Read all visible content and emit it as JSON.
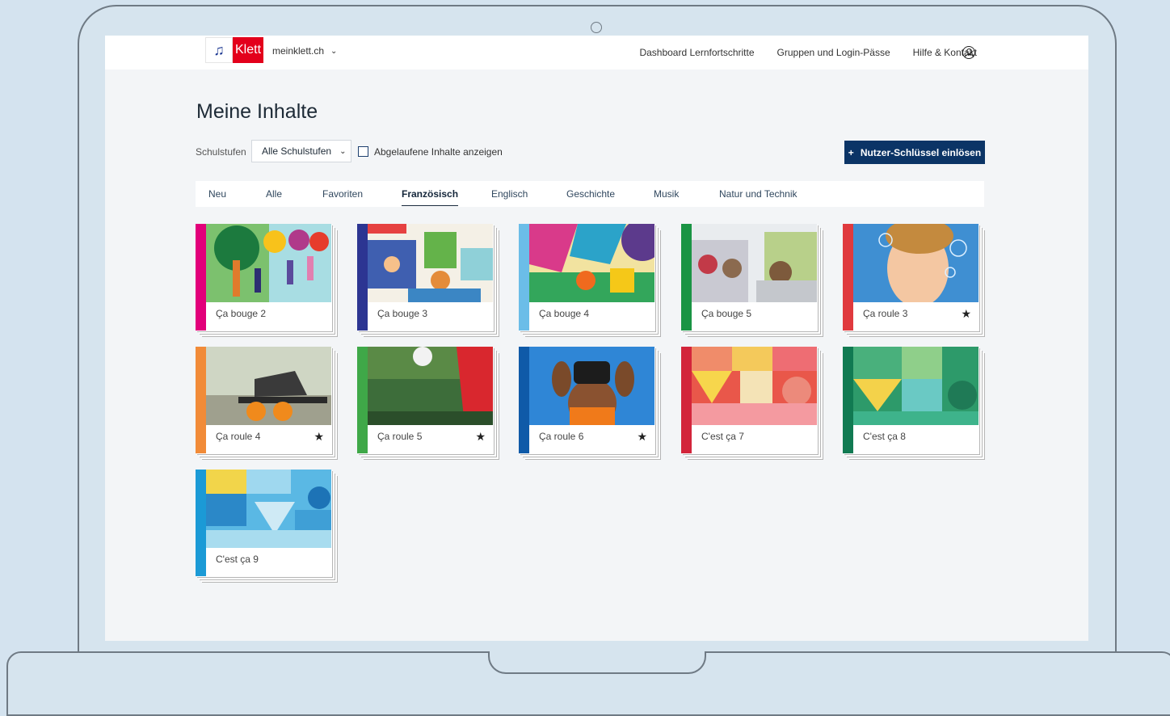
{
  "header": {
    "logo_mark": "♫",
    "logo_text": "Klett",
    "site": "meinklett.ch",
    "nav": [
      "Dashboard Lernfortschritte",
      "Gruppen und Login-Pässe",
      "Hilfe & Kontakt"
    ]
  },
  "page": {
    "title": "Meine Inhalte",
    "filter_label": "Schulstufen",
    "filter_value": "Alle Schulstufen",
    "expired_label": "Abgelaufene Inhalte anzeigen",
    "redeem_label": "Nutzer-Schlüssel einlösen",
    "redeem_icon": "+"
  },
  "tabs": [
    {
      "label": "Neu",
      "active": false
    },
    {
      "label": "Alle",
      "active": false
    },
    {
      "label": "Favoriten",
      "active": false
    },
    {
      "label": "Französisch",
      "active": true
    },
    {
      "label": "Englisch",
      "active": false
    },
    {
      "label": "Geschichte",
      "active": false
    },
    {
      "label": "Musik",
      "active": false
    },
    {
      "label": "Natur und Technik",
      "active": false
    }
  ],
  "products": [
    {
      "title": "Ça bouge 2",
      "stripe": "#e2007a",
      "favorite": false
    },
    {
      "title": "Ça bouge 3",
      "stripe": "#2c3592",
      "favorite": false
    },
    {
      "title": "Ça bouge 4",
      "stripe": "#6bbde8",
      "favorite": false
    },
    {
      "title": "Ça bouge 5",
      "stripe": "#1a9444",
      "favorite": false
    },
    {
      "title": "Ça roule 3",
      "stripe": "#e03a3e",
      "favorite": true
    },
    {
      "title": "Ça roule 4",
      "stripe": "#f18b38",
      "favorite": true
    },
    {
      "title": "Ça roule 5",
      "stripe": "#3fa848",
      "favorite": true
    },
    {
      "title": "Ça roule 6",
      "stripe": "#0f5aa8",
      "favorite": true
    },
    {
      "title": "C'est ça 7",
      "stripe": "#d3253b",
      "favorite": false
    },
    {
      "title": "C'est ça 8",
      "stripe": "#117a52",
      "favorite": false
    },
    {
      "title": "C'est ça 9",
      "stripe": "#1b9ad6",
      "favorite": false
    }
  ],
  "icons": {
    "star": "★",
    "chevron": "⌄",
    "user": "user-circle-icon"
  }
}
